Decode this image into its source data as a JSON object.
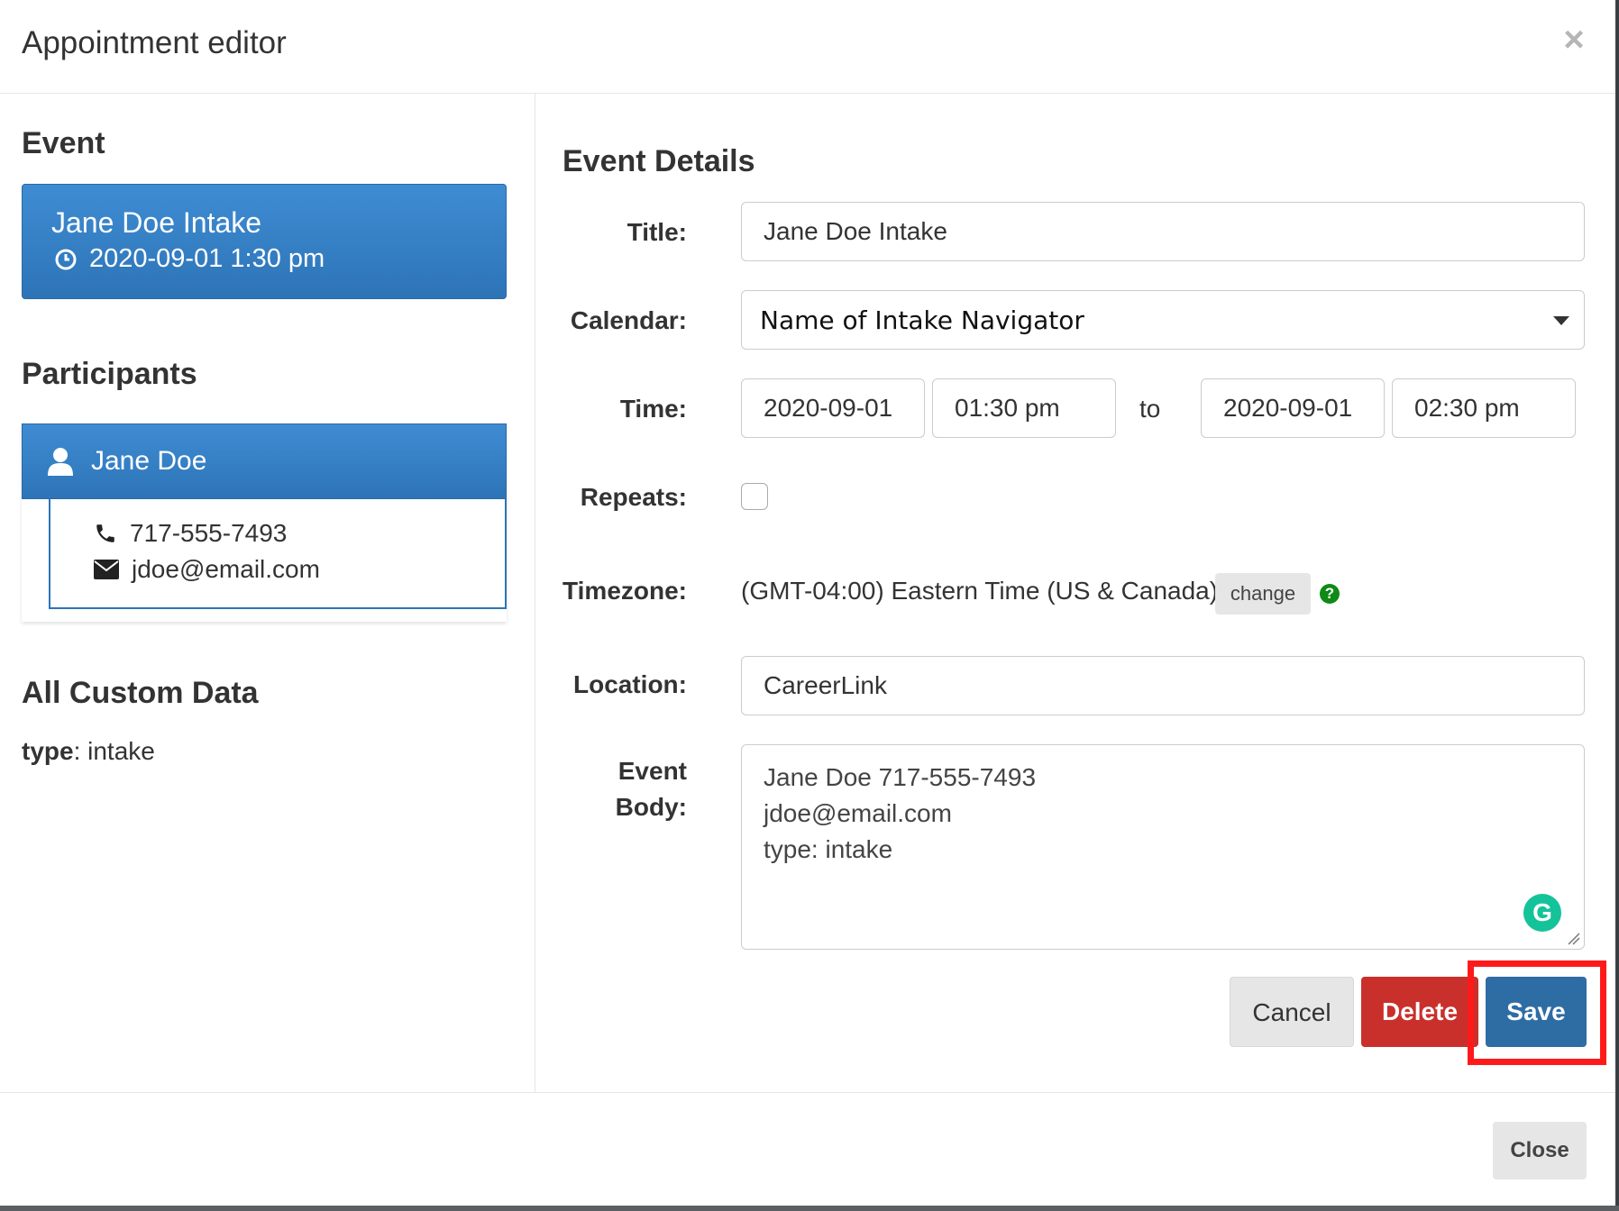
{
  "modal": {
    "title": "Appointment editor"
  },
  "left": {
    "event_heading": "Event",
    "event_card": {
      "title": "Jane Doe Intake",
      "datetime": "2020-09-01 1:30 pm"
    },
    "participants_heading": "Participants",
    "participant": {
      "name": "Jane Doe",
      "phone": "717-555-7493",
      "email": "jdoe@email.com"
    },
    "custom_heading": "All Custom Data",
    "custom_data": {
      "key": "type",
      "value": ": intake"
    }
  },
  "details": {
    "heading": "Event Details",
    "labels": {
      "title": "Title:",
      "calendar": "Calendar:",
      "time": "Time:",
      "repeats": "Repeats:",
      "timezone": "Timezone:",
      "location": "Location:",
      "body_line1": "Event",
      "body_line2": "Body:"
    },
    "title_value": "Jane Doe Intake",
    "calendar_value": "Name of Intake Navigator",
    "start_date": "2020-09-01",
    "start_time": "01:30 pm",
    "to_label": "to",
    "end_date": "2020-09-01",
    "end_time": "02:30 pm",
    "repeats_checked": false,
    "timezone_value": "(GMT-04:00) Eastern Time (US & Canada)",
    "change_label": "change",
    "help_symbol": "?",
    "location_value": "CareerLink",
    "body_lines": [
      "Jane Doe 717-555-7493",
      "jdoe@email.com",
      "type: intake"
    ],
    "grammarly_letter": "G"
  },
  "actions": {
    "cancel": "Cancel",
    "delete": "Delete",
    "save": "Save"
  },
  "footer": {
    "close": "Close"
  },
  "colors": {
    "primary": "#2e6da4",
    "danger": "#c9302c",
    "highlight": "#ff1a1a",
    "help": "#0e8a16",
    "grammarly": "#15c39a"
  }
}
